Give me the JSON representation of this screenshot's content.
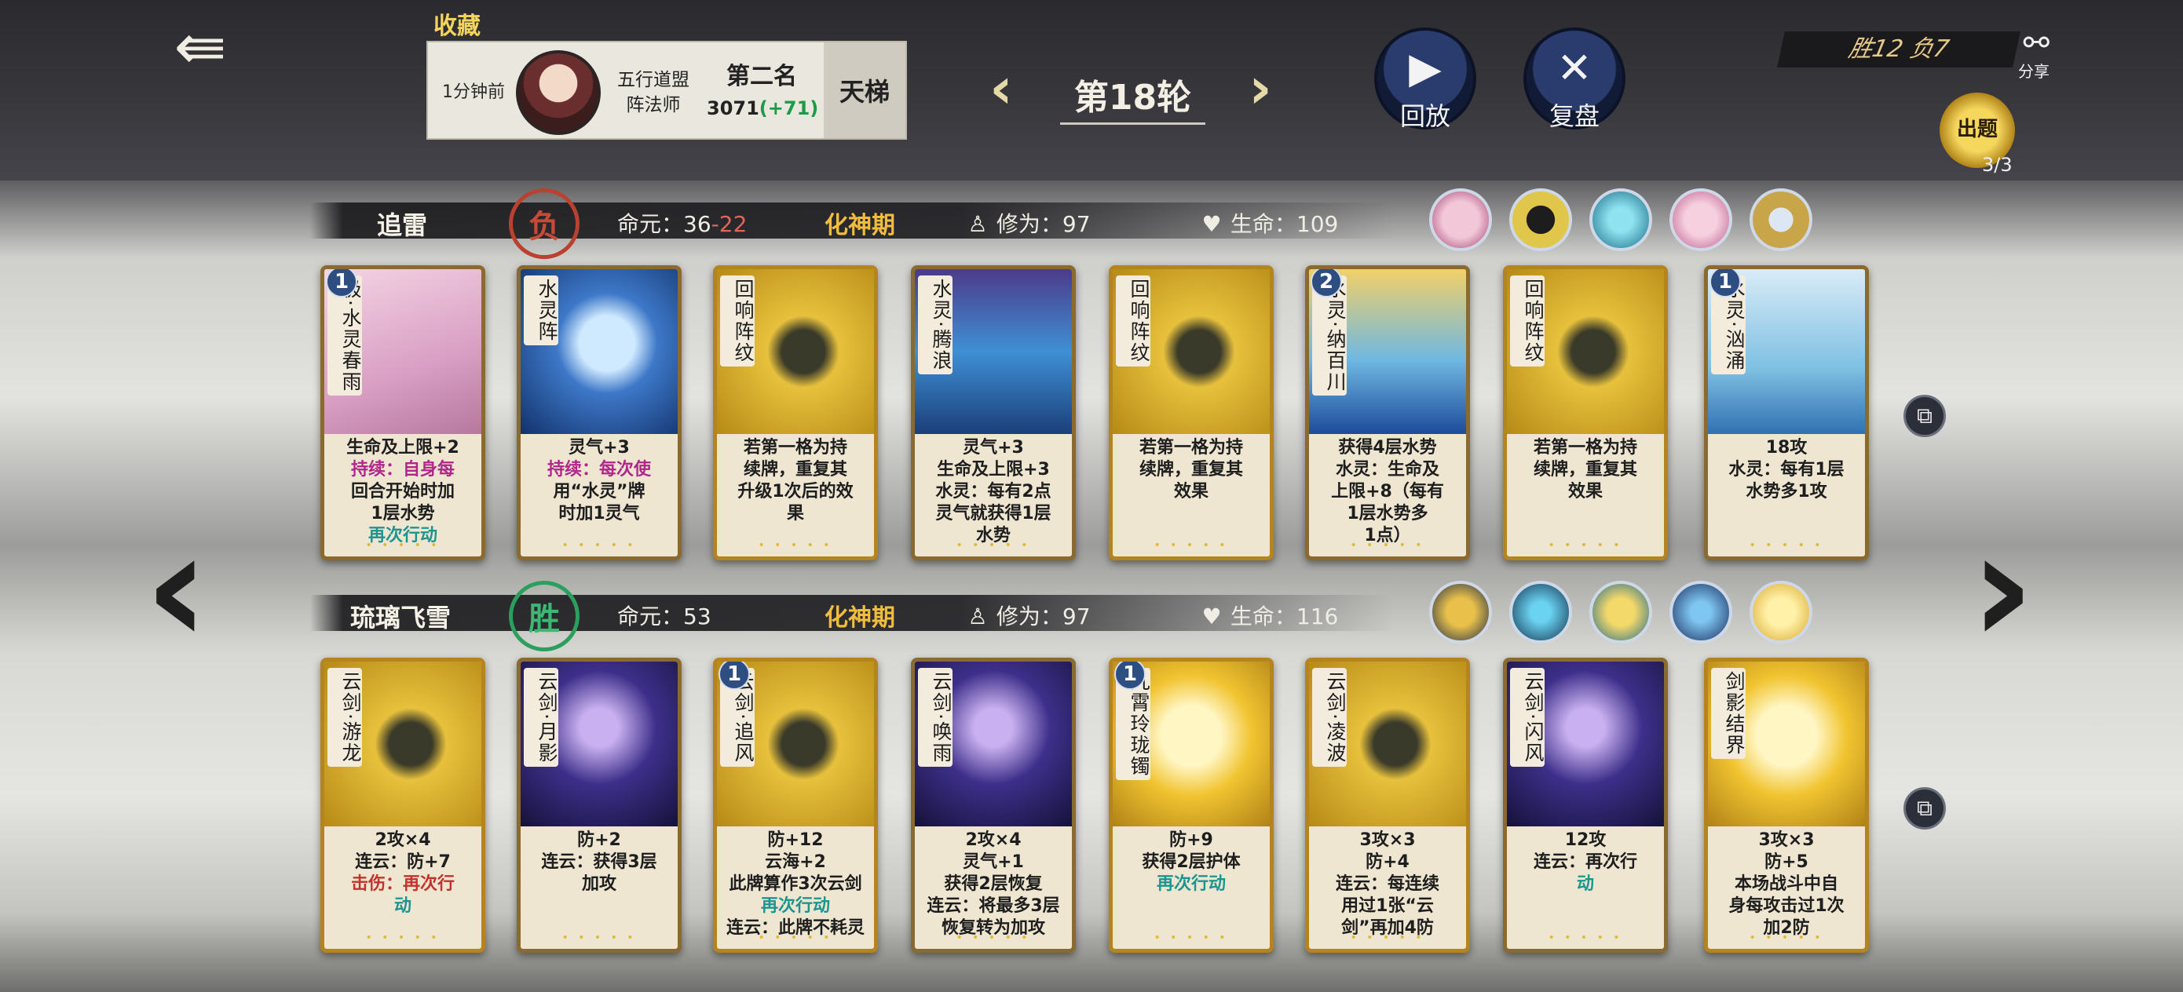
{
  "header": {
    "favorite_label": "收藏",
    "record": {
      "time": "1分钟前",
      "sect_line1": "五行道盟",
      "sect_line2": "阵法师",
      "rank": "第二名",
      "score": "3071",
      "delta": "(+71)",
      "mode": "天梯"
    },
    "round_label": "第18轮",
    "replay_label": "回放",
    "review_label": "复盘",
    "win_loss": "胜12 负7",
    "share_label": "分享",
    "quest_label": "出题",
    "quest_count": "3/3"
  },
  "players": [
    {
      "name": "追雷",
      "result": "负",
      "life_label": "命元：",
      "life_value": "36",
      "life_delta": "-22",
      "realm": "化神期",
      "cultivation": "修为：97",
      "health": "生命：109",
      "cards": [
        {
          "name": "极·水灵春雨",
          "level": "1",
          "theme": "pink",
          "lines": [
            "生命及上限+2",
            "持续：自身每",
            "回合开始时加",
            "1层水势",
            "再次行动"
          ]
        },
        {
          "name": "水灵阵",
          "level": "",
          "theme": "blue",
          "lines": [
            "灵气+3",
            "持续：每次使",
            "用“水灵”牌",
            "时加1灵气"
          ]
        },
        {
          "name": "回响阵纹",
          "level": "",
          "theme": "gold",
          "lines": [
            "若第一格为持",
            "续牌，重复其",
            "升级1次后的效",
            "果"
          ]
        },
        {
          "name": "水灵·腾浪",
          "level": "",
          "theme": "wave",
          "lines": [
            "灵气+3",
            "生命及上限+3",
            "水灵：每有2点",
            "灵气就获得1层",
            "水势"
          ]
        },
        {
          "name": "回响阵纹",
          "level": "",
          "theme": "gold",
          "lines": [
            "若第一格为持",
            "续牌，重复其",
            "效果"
          ]
        },
        {
          "name": "水灵·纳百川",
          "level": "2",
          "theme": "dragon",
          "lines": [
            "获得4层水势",
            "水灵：生命及",
            "上限+8（每有",
            "1层水势多",
            "1点）"
          ]
        },
        {
          "name": "回响阵纹",
          "level": "",
          "theme": "gold",
          "lines": [
            "若第一格为持",
            "续牌，重复其",
            "效果"
          ]
        },
        {
          "name": "水灵·汹涌",
          "level": "1",
          "theme": "wave2",
          "lines": [
            "18攻",
            "水灵：每有1层",
            "水势多1攻"
          ]
        }
      ]
    },
    {
      "name": "琉璃飞雪",
      "result": "胜",
      "life_label": "命元：",
      "life_value": "53",
      "life_delta": "",
      "realm": "化神期",
      "cultivation": "修为：97",
      "health": "生命：116",
      "cards": [
        {
          "name": "云剑·游龙",
          "level": "",
          "theme": "gold",
          "lines": [
            "2攻×4",
            "连云：防+7",
            "击伤：再次行",
            "动"
          ]
        },
        {
          "name": "云剑·月影",
          "level": "",
          "theme": "night",
          "lines": [
            "防+2",
            "连云：获得3层",
            "加攻"
          ]
        },
        {
          "name": "云剑·追风",
          "level": "1",
          "theme": "gold",
          "lines": [
            "防+12",
            "云海+2",
            "此牌算作3次云剑",
            "再次行动",
            "连云：此牌不耗灵",
            "气"
          ]
        },
        {
          "name": "云剑·唤雨",
          "level": "",
          "theme": "night",
          "lines": [
            "2攻×4",
            "灵气+1",
            "获得2层恢复",
            "连云：将最多3层",
            "恢复转为加攻"
          ]
        },
        {
          "name": "九霄玲珑镯",
          "level": "1",
          "theme": "sun",
          "lines": [
            "防+9",
            "获得2层护体",
            "再次行动"
          ]
        },
        {
          "name": "云剑·凌波",
          "level": "",
          "theme": "gold",
          "lines": [
            "3攻×3",
            "防+4",
            "连云：每连续",
            "用过1张“云",
            "剑”再加4防"
          ]
        },
        {
          "name": "云剑·闪风",
          "level": "",
          "theme": "night",
          "lines": [
            "12攻",
            "连云：再次行",
            "动"
          ]
        },
        {
          "name": "剑影结界",
          "level": "",
          "theme": "sun",
          "lines": [
            "3攻×3",
            "防+5",
            "本场战斗中自",
            "身每攻击过1次",
            "加2防"
          ]
        }
      ]
    }
  ],
  "colors": {
    "accent_gold": "#f1bd3e",
    "win_green": "#3cb874",
    "lose_red": "#c54a38",
    "keyword_teal": "#1c9590",
    "keyword_magenta": "#b0268a",
    "damage_red": "#c3322c"
  },
  "icons": {
    "back": "back-arrow-icon",
    "replay": "play-icon",
    "review": "crossed-swords-icon",
    "share": "share-icon",
    "cultivation": "meditation-icon",
    "health": "heart-icon",
    "copy": "copy-icon"
  }
}
